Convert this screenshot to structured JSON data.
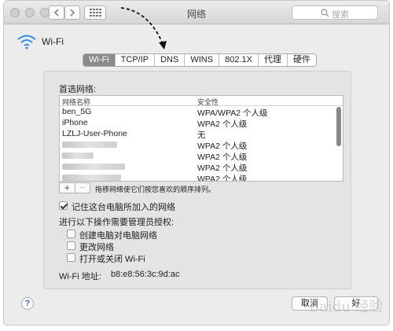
{
  "window": {
    "title": "网络"
  },
  "search": {
    "placeholder": "搜索"
  },
  "wifi": {
    "label": "Wi-Fi"
  },
  "tabs": [
    {
      "label": "Wi-Fi",
      "active": true
    },
    {
      "label": "TCP/IP",
      "active": false
    },
    {
      "label": "DNS",
      "active": false
    },
    {
      "label": "WINS",
      "active": false
    },
    {
      "label": "802.1X",
      "active": false
    },
    {
      "label": "代理",
      "active": false
    },
    {
      "label": "硬件",
      "active": false
    }
  ],
  "preferred": {
    "heading": "首选网络:",
    "columns": [
      "网络名称",
      "安全性"
    ],
    "rows": [
      {
        "name": "ben_5G",
        "security": "WPA/WPA2 个人级"
      },
      {
        "name": "iPhone",
        "security": "WPA2 个人级"
      },
      {
        "name": "LZLJ-User-Phone",
        "security": "无"
      },
      {
        "name": "",
        "security": "WPA2 个人级"
      },
      {
        "name": "",
        "security": "WPA2 个人级"
      },
      {
        "name": "",
        "security": "WPA2 个人级"
      },
      {
        "name": "",
        "security": "WPA2 个人级"
      }
    ],
    "add_label": "+",
    "remove_label": "−",
    "drag_hint": "拖移网络使它们按您喜欢的顺序排列。"
  },
  "remember": {
    "label": "记住这台电脑所加入的网络",
    "checked": true
  },
  "admin": {
    "heading": "进行以下操作需要管理员授权:",
    "options": [
      {
        "label": "创建电脑对电脑网络",
        "checked": false
      },
      {
        "label": "更改网络",
        "checked": false
      },
      {
        "label": "打开或关闭 Wi-Fi",
        "checked": false
      }
    ]
  },
  "address": {
    "label": "Wi-Fi 地址:",
    "value": "b8:e8:56:3c:9d:ac"
  },
  "footer": {
    "help": "?",
    "cancel": "取消",
    "ok": "好"
  },
  "watermark": "Baidu 经验"
}
